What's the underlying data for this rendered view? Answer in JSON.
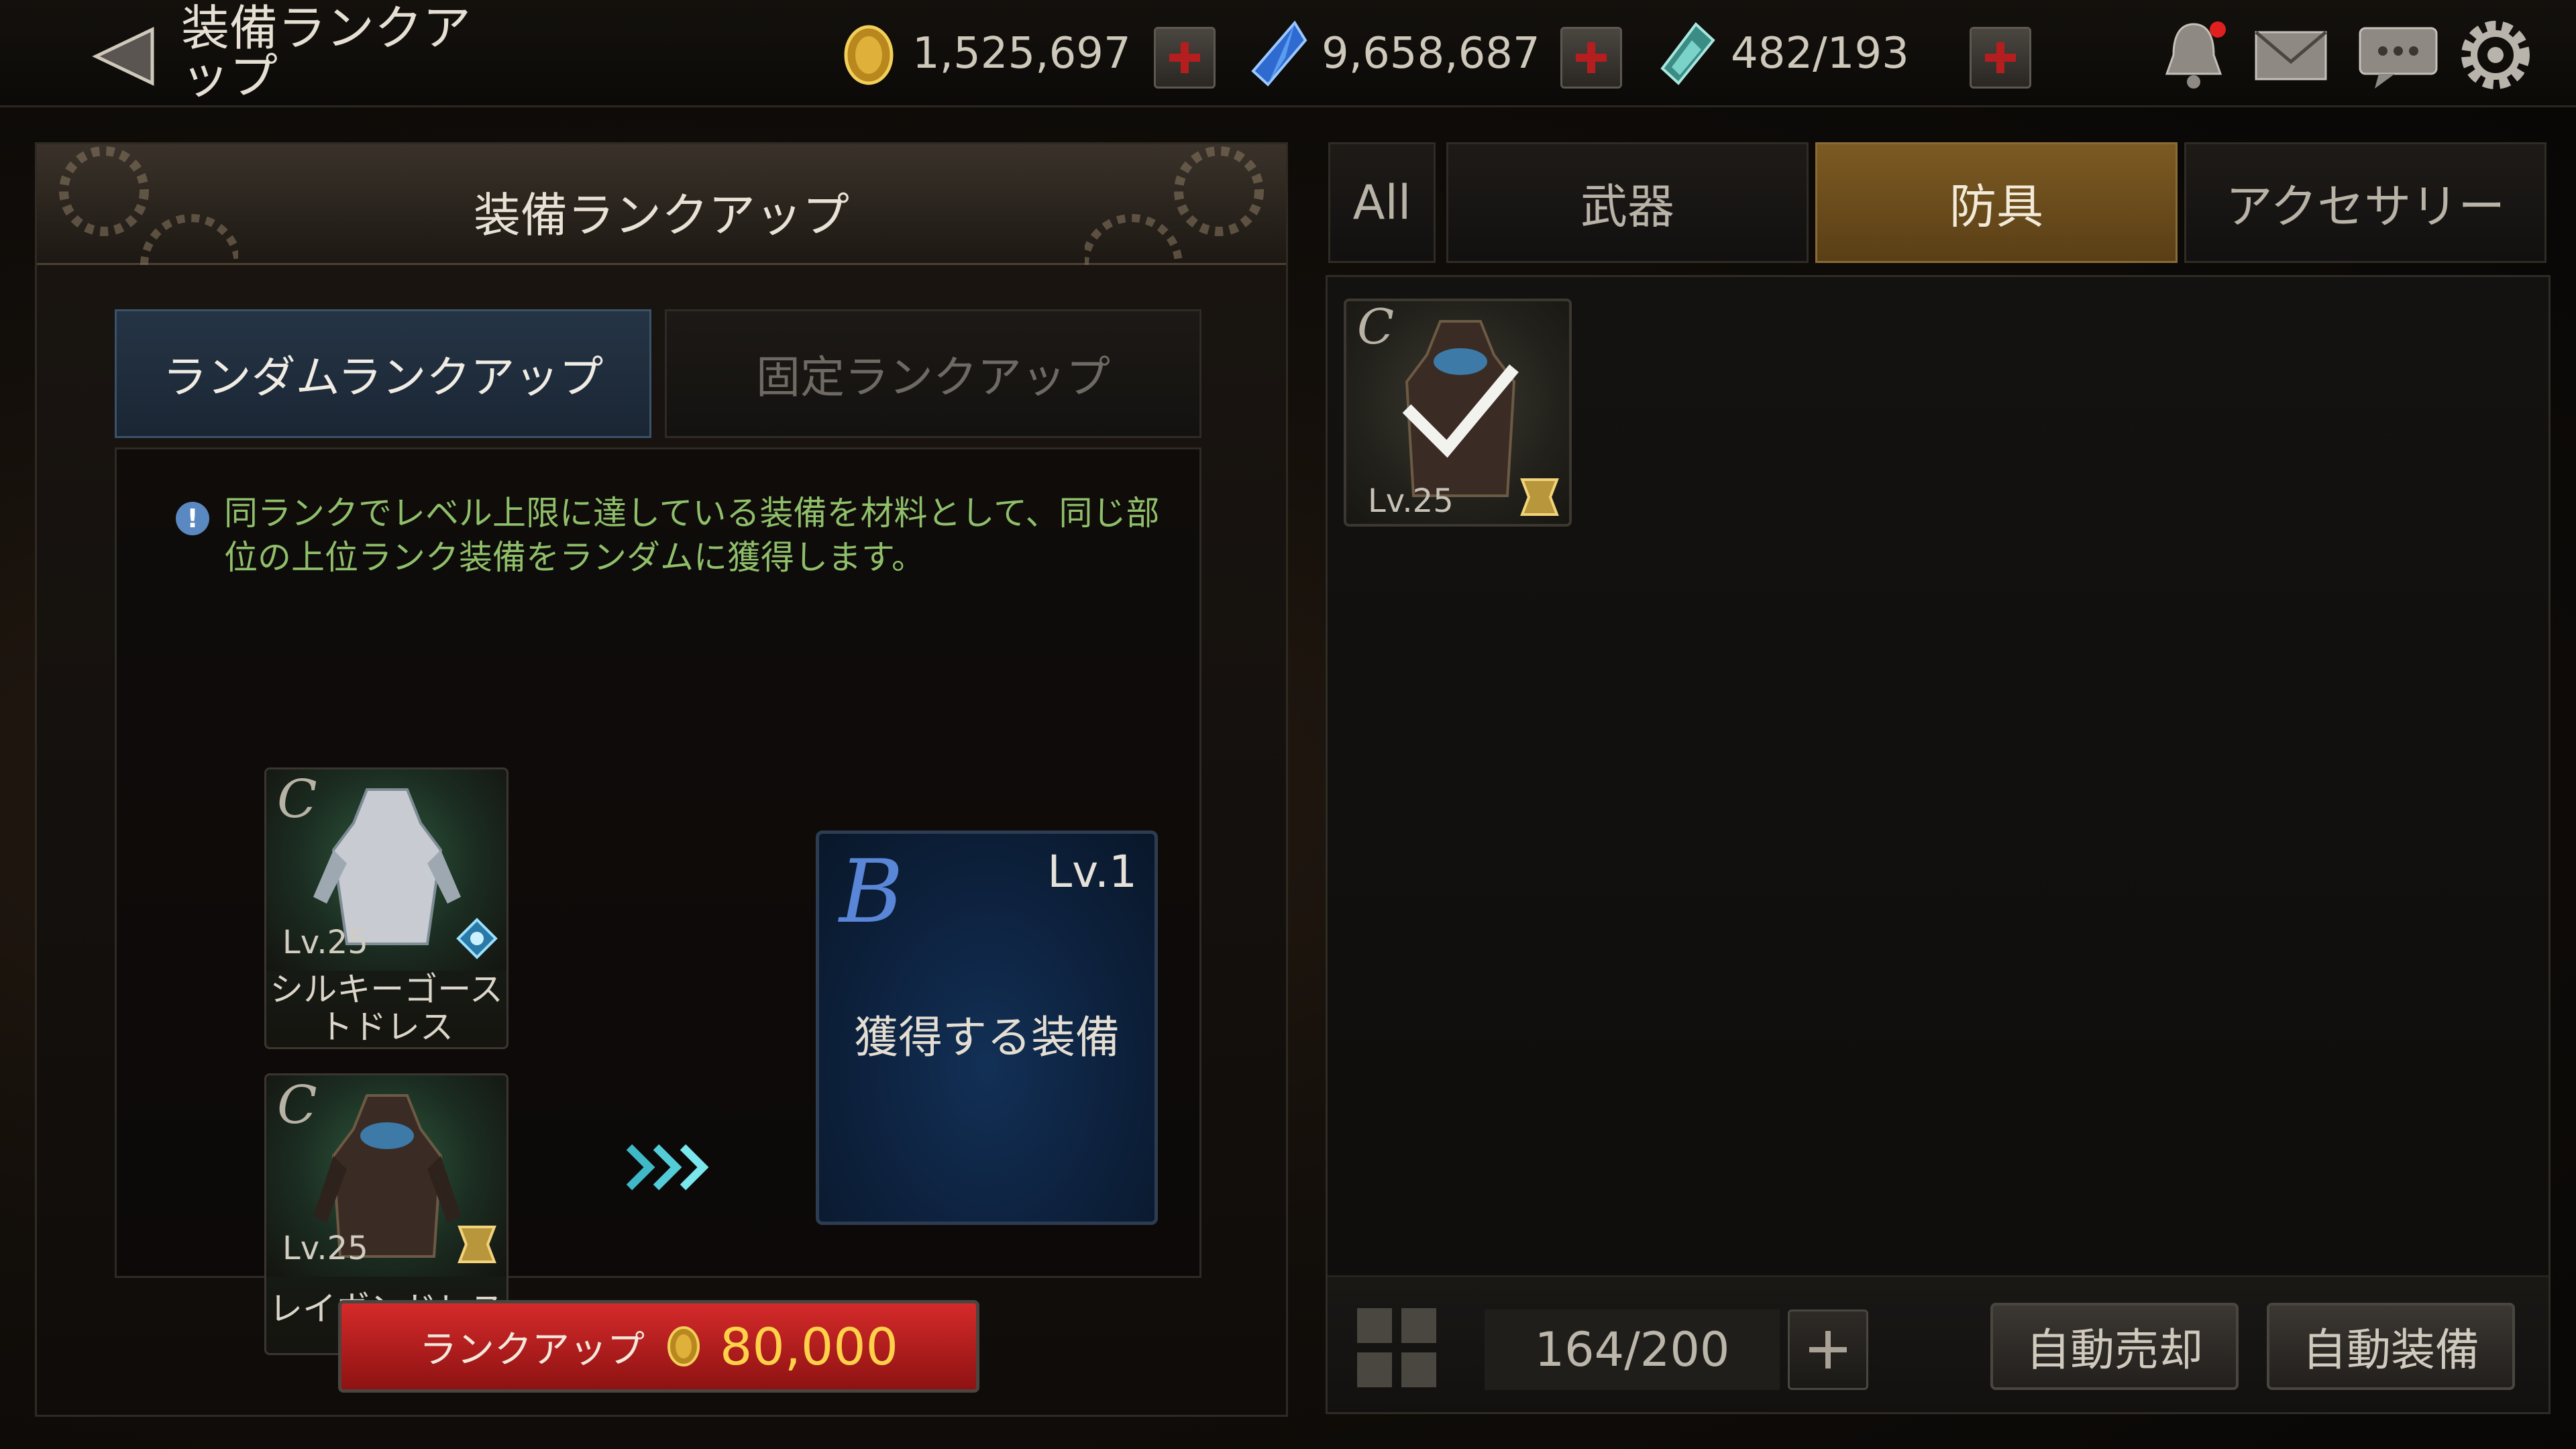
{
  "header": {
    "title": "装備ランクアップ",
    "gold": "1,525,697",
    "crystal": "9,658,687",
    "stamina": "482/193"
  },
  "panel": {
    "title": "装備ランクアップ",
    "tabs": {
      "random": "ランダムランクアップ",
      "fixed": "固定ランクアップ"
    },
    "info": "同ランクでレベル上限に達している装備を材料として、同じ部位の上位ランク装備をランダムに獲得します。",
    "materials": [
      {
        "grade": "C",
        "level": "Lv.25",
        "name": "シルキーゴーストドレス"
      },
      {
        "grade": "C",
        "level": "Lv.25",
        "name": "レイヴンドレス"
      }
    ],
    "result": {
      "grade": "B",
      "level": "Lv.1",
      "label": "獲得する装備"
    },
    "rankup": {
      "label": "ランクアップ",
      "cost": "80,000"
    }
  },
  "inventory": {
    "tabs": [
      "All",
      "武器",
      "防具",
      "アクセサリー"
    ],
    "active_tab": "防具",
    "items": [
      {
        "grade": "C",
        "level": "Lv.25",
        "selected": true
      }
    ],
    "count": "164/200",
    "auto_sell": "自動売却",
    "auto_equip": "自動装備"
  },
  "colors": {
    "accent_tab": "#7c5a22",
    "rankup_button": "#c62020",
    "cost_text": "#ffd24a",
    "info_text": "#8fbf6a"
  }
}
